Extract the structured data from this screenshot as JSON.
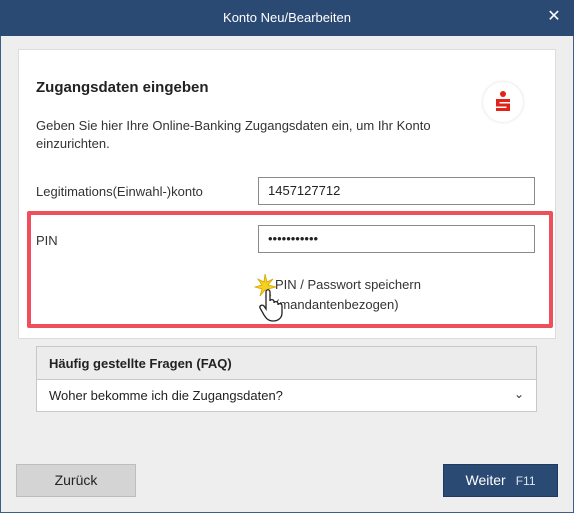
{
  "window": {
    "title": "Konto Neu/Bearbeiten",
    "close_glyph": "✕"
  },
  "card": {
    "heading": "Zugangsdaten eingeben",
    "description": "Geben Sie hier Ihre Online-Banking Zugangsdaten ein, um Ihr Konto einzurichten.",
    "logo_icon": "sparkasse-logo-icon"
  },
  "form": {
    "account_label": "Legitimations(Einwahl-)konto",
    "account_value": "1457127712",
    "pin_label": "PIN",
    "pin_value": "•••••••••••",
    "save_line1": "PIN / Passwort speichern",
    "save_line2": "(mandantenbezogen)"
  },
  "faq": {
    "title": "Häufig gestellte Fragen (FAQ)",
    "item": "Woher bekomme ich die Zugangsdaten?",
    "chevron": "⌄"
  },
  "buttons": {
    "back": "Zurück",
    "next": "Weiter",
    "next_key": "F11"
  },
  "colors": {
    "titlebar": "#2b4a73",
    "highlight": "#ef4f5a",
    "logo": "#e2231a"
  }
}
